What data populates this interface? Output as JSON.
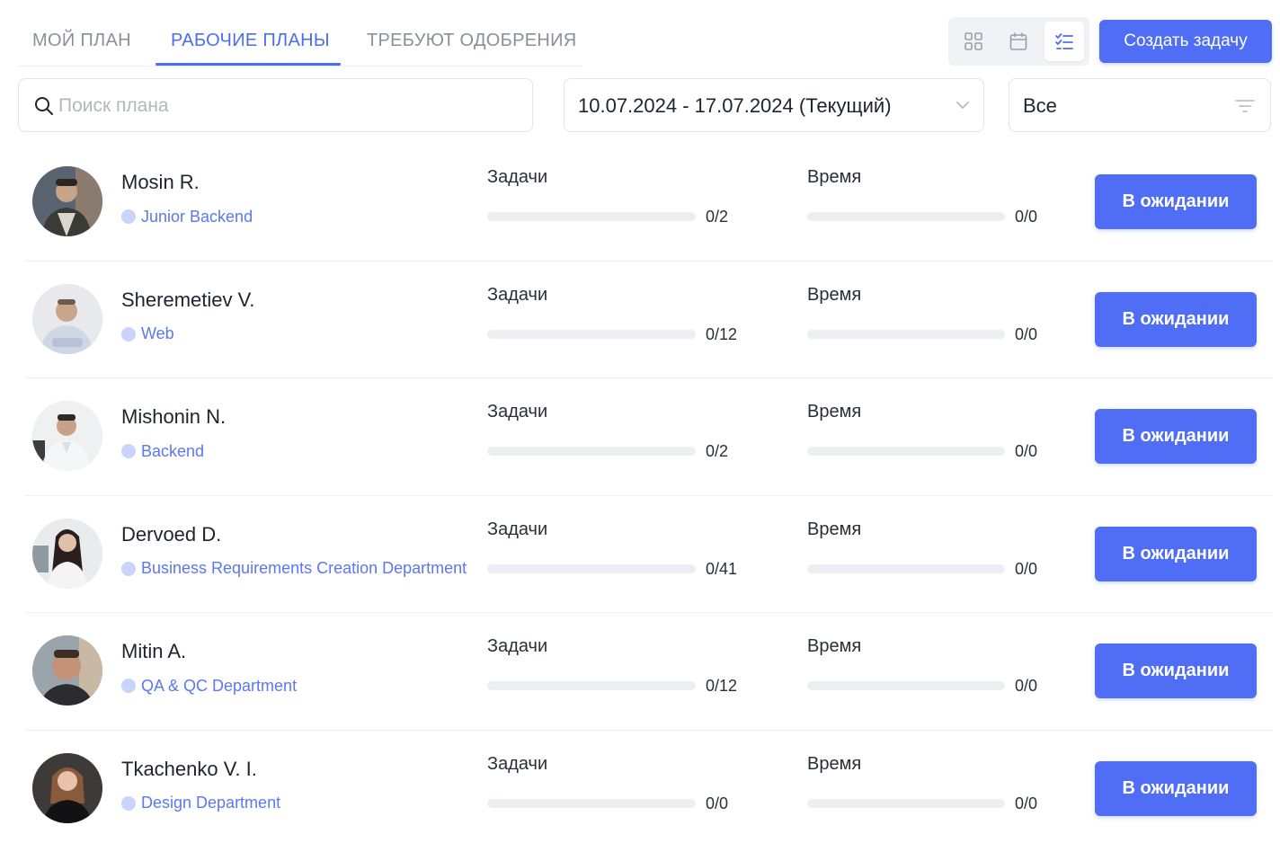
{
  "tabs": [
    {
      "label": "МОЙ ПЛАН",
      "active": false
    },
    {
      "label": "РАБОЧИЕ ПЛАНЫ",
      "active": true
    },
    {
      "label": "ТРЕБУЮТ ОДОБРЕНИЯ",
      "active": false
    }
  ],
  "view_toggle": {
    "active": "list",
    "options": [
      "grid-icon",
      "calendar-icon",
      "checklist-icon"
    ]
  },
  "toolbar": {
    "create_label": "Создать задачу"
  },
  "search": {
    "placeholder": "Поиск плана",
    "value": ""
  },
  "period_select": {
    "value": "10.07.2024 - 17.07.2024 (Текущий)"
  },
  "filter_select": {
    "value": "Все"
  },
  "colors": {
    "accent": "#4f6df5",
    "dept_text": "#5a78f2",
    "dept_dot": "#c9d3fb"
  },
  "plans": [
    {
      "name": "Mosin R.",
      "department": "Junior Backend",
      "tasks_label": "Задачи",
      "tasks_value": "0/2",
      "tasks_progress": 0,
      "time_label": "Время",
      "time_value": "0/0",
      "time_progress": 0,
      "status": "В ожидании"
    },
    {
      "name": "Sheremetiev V.",
      "department": "Web",
      "tasks_label": "Задачи",
      "tasks_value": "0/12",
      "tasks_progress": 0,
      "time_label": "Время",
      "time_value": "0/0",
      "time_progress": 0,
      "status": "В ожидании"
    },
    {
      "name": "Mishonin N.",
      "department": "Backend",
      "tasks_label": "Задачи",
      "tasks_value": "0/2",
      "tasks_progress": 0,
      "time_label": "Время",
      "time_value": "0/0",
      "time_progress": 0,
      "status": "В ожидании"
    },
    {
      "name": "Dervoed D.",
      "department": "Business Requirements Creation Department",
      "tasks_label": "Задачи",
      "tasks_value": "0/41",
      "tasks_progress": 0,
      "time_label": "Время",
      "time_value": "0/0",
      "time_progress": 0,
      "status": "В ожидании"
    },
    {
      "name": "Mitin A.",
      "department": "QA & QC Department",
      "tasks_label": "Задачи",
      "tasks_value": "0/12",
      "tasks_progress": 0,
      "time_label": "Время",
      "time_value": "0/0",
      "time_progress": 0,
      "status": "В ожидании"
    },
    {
      "name": "Tkachenko V. I.",
      "department": "Design Department",
      "tasks_label": "Задачи",
      "tasks_value": "0/0",
      "tasks_progress": 0,
      "time_label": "Время",
      "time_value": "0/0",
      "time_progress": 0,
      "status": "В ожидании"
    }
  ]
}
